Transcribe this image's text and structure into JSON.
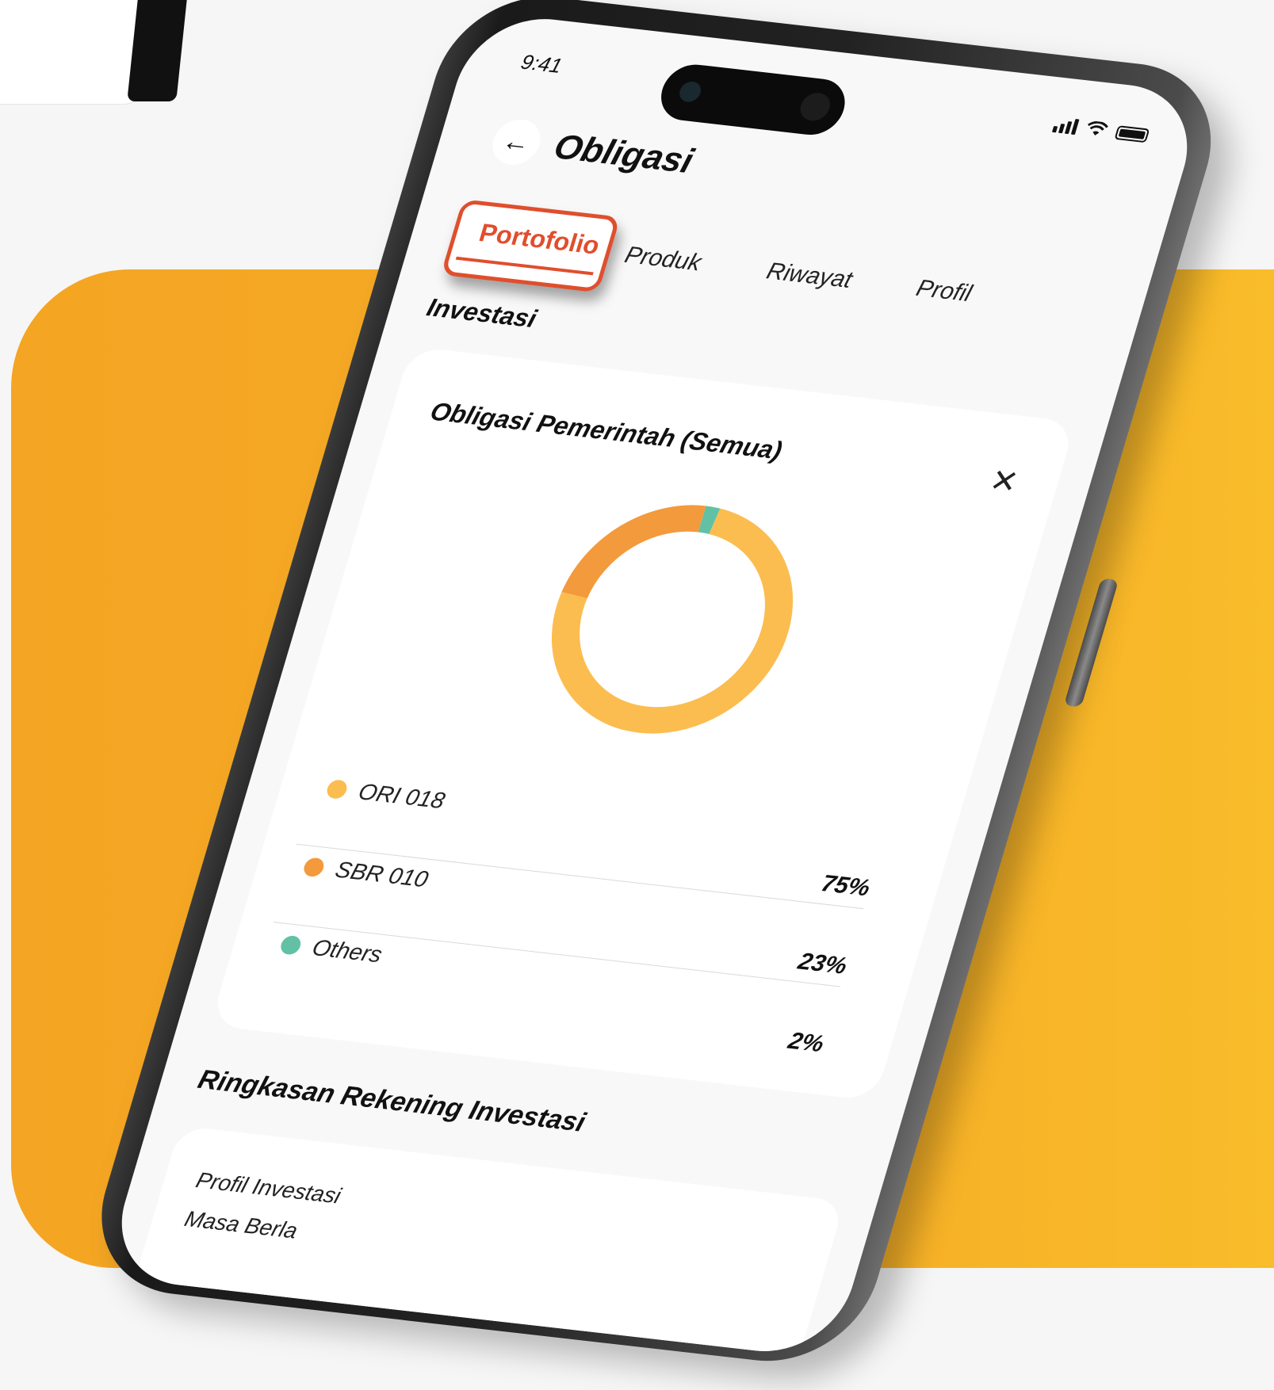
{
  "status_bar": {
    "time": "9:41"
  },
  "header": {
    "back_icon": "arrow-left-icon",
    "title": "Obligasi"
  },
  "tabs": [
    {
      "label": "Portofolio",
      "active": true
    },
    {
      "label": "Produk",
      "active": false
    },
    {
      "label": "Riwayat",
      "active": false
    },
    {
      "label": "Profil",
      "active": false
    }
  ],
  "investasi": {
    "section_title": "Investasi",
    "card_title": "Obligasi Pemerintah (Semua)",
    "close_icon": "close-icon"
  },
  "chart_data": {
    "type": "pie",
    "categories": [
      "ORI 018",
      "SBR 010",
      "Others"
    ],
    "values": [
      75,
      23,
      2
    ],
    "value_labels": [
      "75%",
      "23%",
      "2%"
    ],
    "colors": [
      "#fbbd4f",
      "#f39a3c",
      "#62c1a4"
    ]
  },
  "ringkasan": {
    "section_title": "Ringkasan Rekening Investasi",
    "rows": [
      "Profil Investasi",
      "Masa Berla"
    ]
  },
  "colors": {
    "accent": "#e04e2c",
    "orange_panel": "#f4a523"
  }
}
